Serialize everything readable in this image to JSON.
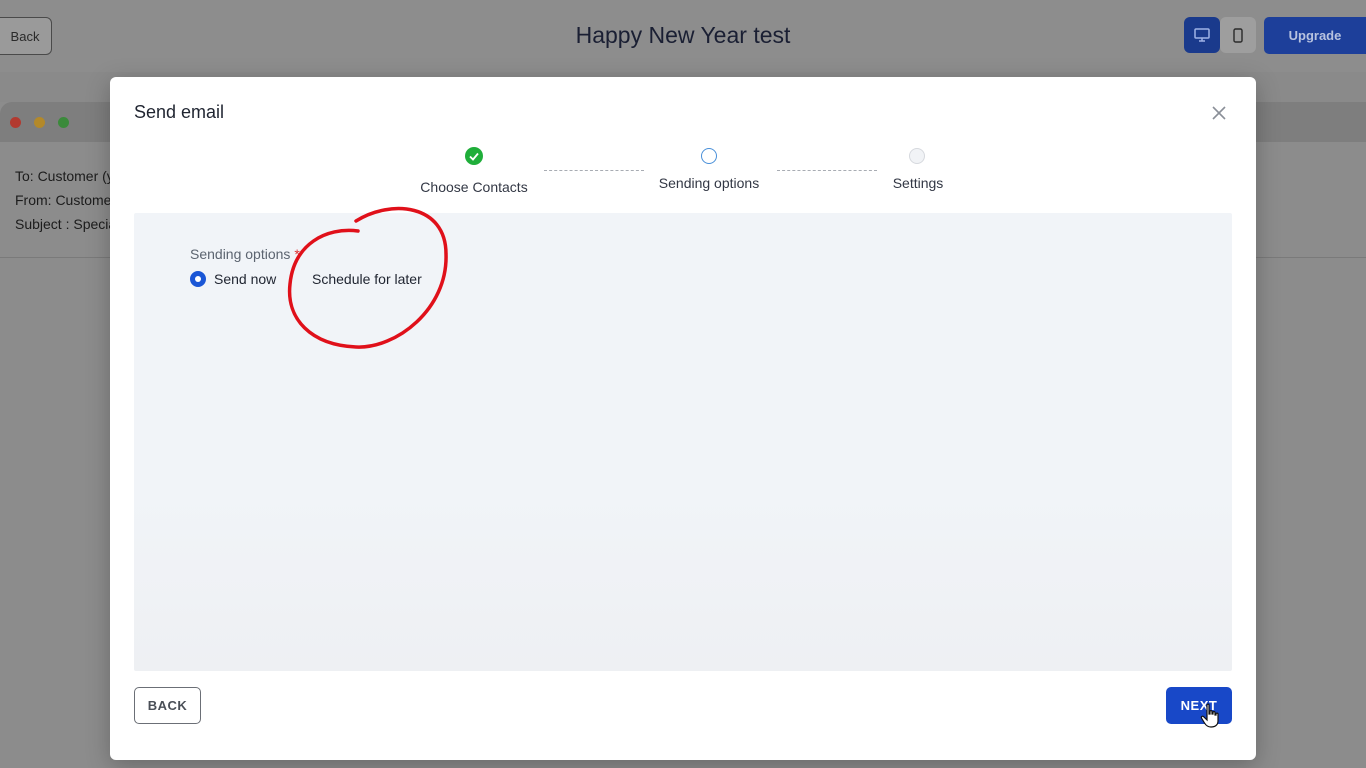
{
  "app": {
    "back_label": "Back",
    "title": "Happy New Year test",
    "upgrade_label": "Upgrade",
    "device_icons": [
      "desktop-icon",
      "mobile-icon"
    ]
  },
  "email_preview": {
    "to": "To: Customer (y",
    "from": "From: Custome",
    "subject": "Subject : Specia"
  },
  "modal": {
    "title": "Send email",
    "steps": [
      {
        "label": "Choose Contacts",
        "state": "complete"
      },
      {
        "label": "Sending options",
        "state": "active"
      },
      {
        "label": "Settings",
        "state": "pending"
      }
    ],
    "sending_options": {
      "label": "Sending options",
      "required_mark": "*",
      "options": [
        {
          "label": "Send now",
          "selected": true
        },
        {
          "label": "Schedule for later",
          "selected": false
        }
      ]
    },
    "back_button": "BACK",
    "next_button": "NEXT"
  },
  "colors": {
    "primary": "#1848c8",
    "step_complete": "#1fae3a",
    "step_active": "#4a90d9",
    "annotation": "#e0101a"
  }
}
